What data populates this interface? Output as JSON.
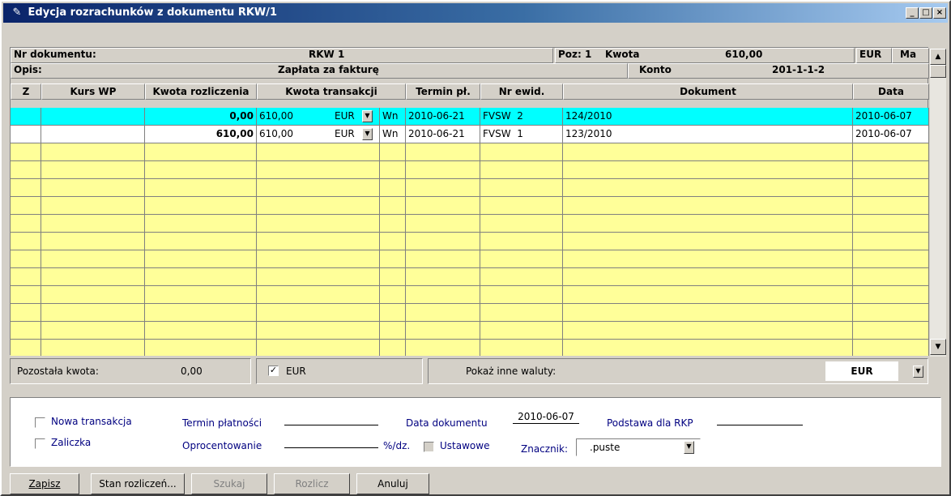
{
  "window": {
    "title": "Edycja rozrachunków z dokumentu RKW/1"
  },
  "header": {
    "nr_label": "Nr dokumentu:",
    "nr_value": "RKW 1",
    "poz_label": "Poz: 1",
    "kwota_label": "Kwota",
    "kwota_value": "610,00",
    "currency": "EUR",
    "ma_label": "Ma",
    "opis_label": "Opis:",
    "opis_value": "Zapłata za fakturę",
    "konto_label": "Konto",
    "konto_value": "201-1-1-2"
  },
  "columns": [
    "Z",
    "Kurs WP",
    "Kwota rozliczenia",
    "Kwota transakcji",
    "Termin pł.",
    "Nr ewid.",
    "Dokument",
    "Data"
  ],
  "rows": [
    {
      "kwota_rozl": "0,00",
      "kwota_trans": "610,00",
      "waluta": "EUR",
      "strona": "Wn",
      "termin": "2010-06-21",
      "nr_ewid": "FVSW  2",
      "dokument": "124/2010",
      "data": "2010-06-07"
    },
    {
      "kwota_rozl": "610,00",
      "kwota_trans": "610,00",
      "waluta": "EUR",
      "strona": "Wn",
      "termin": "2010-06-21",
      "nr_ewid": "FVSW  1",
      "dokument": "123/2010",
      "data": "2010-06-07"
    }
  ],
  "status": {
    "pozostala_label": "Pozostała kwota:",
    "pozostala_value": "0,00",
    "eur_check_label": "EUR",
    "pokaz_label": "Pokaż inne waluty:",
    "pokaz_value": "EUR"
  },
  "form": {
    "nowa_transakcja": "Nowa transakcja",
    "zaliczka": "Zaliczka",
    "termin_platnosci": "Termin płatności",
    "oprocentowanie": "Oprocentowanie",
    "procent_dz": "%/dz.",
    "ustawowe": "Ustawowe",
    "data_dokumentu": "Data dokumentu",
    "data_dokumentu_value": "2010-06-07",
    "podstawa_rkp": "Podstawa dla RKP",
    "znacznik": "Znacznik:",
    "znacznik_value": ".puste"
  },
  "buttons": {
    "zapisz": "Zapisz",
    "stan": "Stan rozliczeń...",
    "szukaj": "Szukaj",
    "rozlicz": "Rozlicz",
    "anuluj": "Anuluj"
  },
  "colors": {
    "selected_row": "#00ffff",
    "empty_rows": "#ffff99",
    "title_bar": "#0a246a"
  }
}
